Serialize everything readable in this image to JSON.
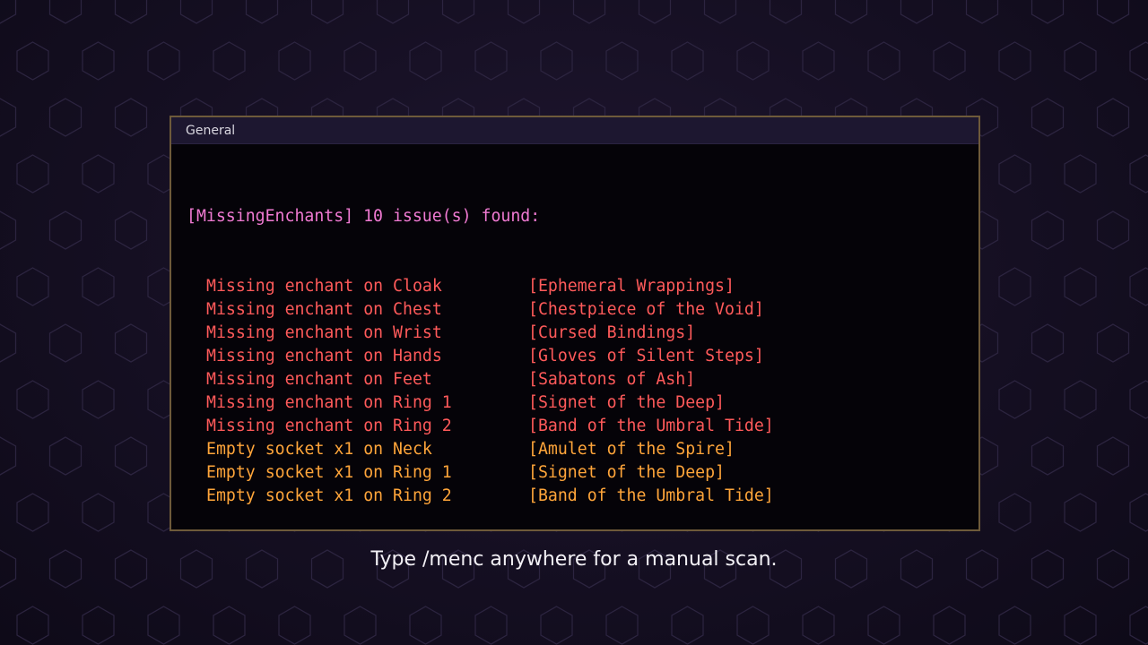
{
  "chat": {
    "tab_label": "General",
    "header": {
      "addon_tag": "[MissingEnchants]",
      "summary": "10 issue(s) found:"
    },
    "lines": [
      {
        "kind": "enchant",
        "text": "Missing enchant on Cloak",
        "item": "[Ephemeral Wrappings]"
      },
      {
        "kind": "enchant",
        "text": "Missing enchant on Chest",
        "item": "[Chestpiece of the Void]"
      },
      {
        "kind": "enchant",
        "text": "Missing enchant on Wrist",
        "item": "[Cursed Bindings]"
      },
      {
        "kind": "enchant",
        "text": "Missing enchant on Hands",
        "item": "[Gloves of Silent Steps]"
      },
      {
        "kind": "enchant",
        "text": "Missing enchant on Feet",
        "item": "[Sabatons of Ash]"
      },
      {
        "kind": "enchant",
        "text": "Missing enchant on Ring 1",
        "item": "[Signet of the Deep]"
      },
      {
        "kind": "enchant",
        "text": "Missing enchant on Ring 2",
        "item": "[Band of the Umbral Tide]"
      },
      {
        "kind": "socket",
        "text": "Empty socket x1 on Neck",
        "item": "[Amulet of the Spire]"
      },
      {
        "kind": "socket",
        "text": "Empty socket x1 on Ring 1",
        "item": "[Signet of the Deep]"
      },
      {
        "kind": "socket",
        "text": "Empty socket x1 on Ring 2",
        "item": "[Band of the Umbral Tide]"
      }
    ]
  },
  "caption": "Type /menc anywhere for a manual scan.",
  "colors": {
    "header": "#f07ad2",
    "missing_enchant": "#ff5a5a",
    "empty_socket": "#ffa53a",
    "frame_border": "#6e5a3a"
  }
}
